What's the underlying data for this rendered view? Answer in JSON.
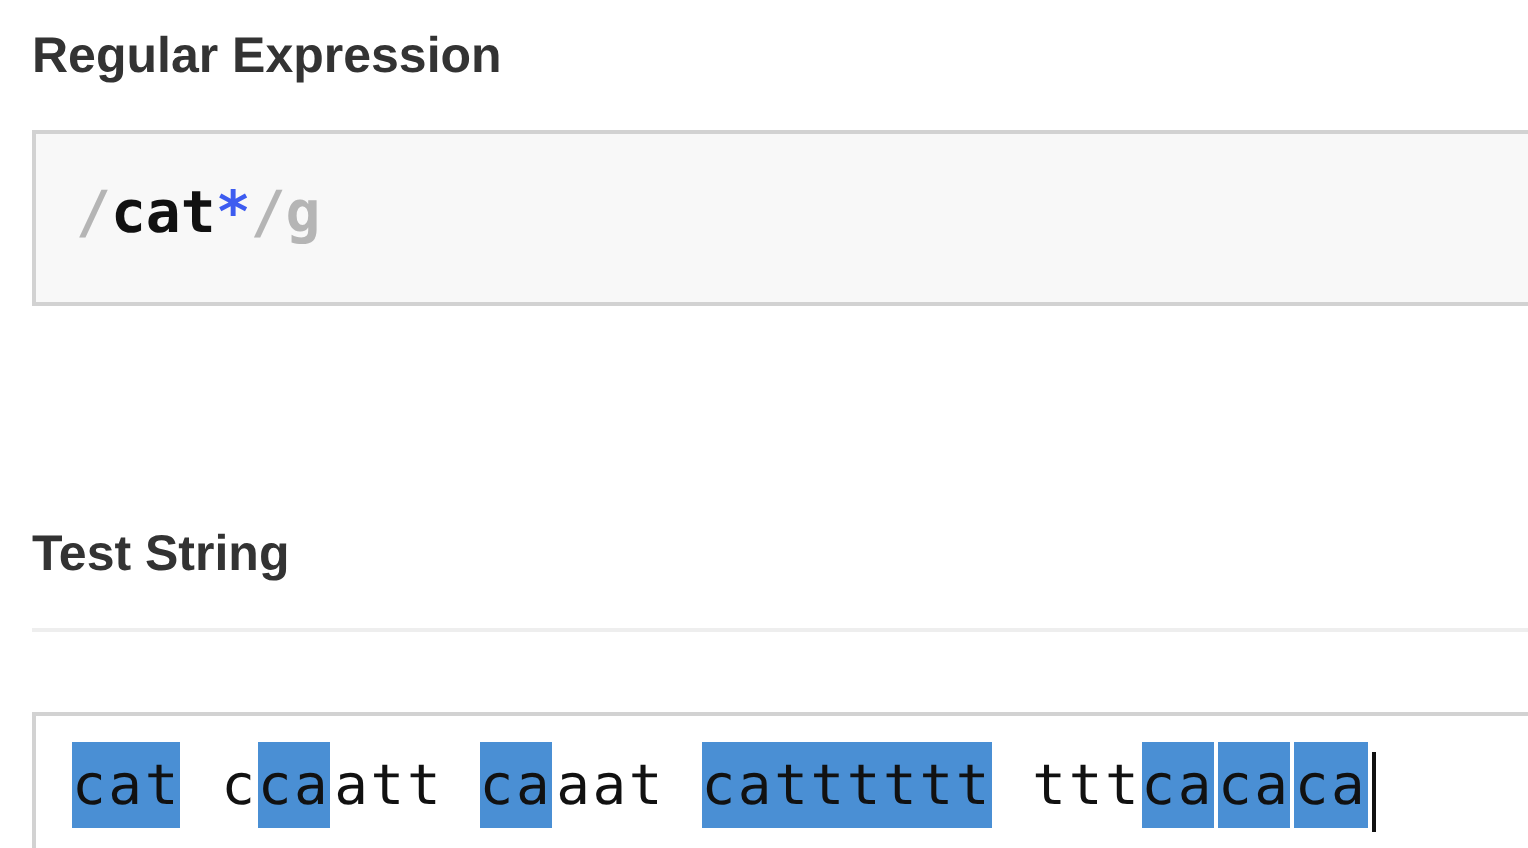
{
  "regex_section": {
    "heading": "Regular Expression",
    "tokens": [
      {
        "kind": "delimiter",
        "text": "/"
      },
      {
        "kind": "literal",
        "text": "cat"
      },
      {
        "kind": "quantifier",
        "text": "*"
      },
      {
        "kind": "delimiter",
        "text": "/"
      },
      {
        "kind": "flags",
        "text": "g"
      }
    ]
  },
  "test_section": {
    "heading": "Test String",
    "segments": [
      {
        "text": "cat",
        "matched": true
      },
      {
        "text": " c",
        "matched": false
      },
      {
        "text": "ca",
        "matched": true
      },
      {
        "text": "att ",
        "matched": false
      },
      {
        "text": "ca",
        "matched": true
      },
      {
        "text": "aat ",
        "matched": false
      },
      {
        "text": "catttttt",
        "matched": true
      },
      {
        "text": " ttt",
        "matched": false
      },
      {
        "text": "ca",
        "matched": true
      },
      {
        "text": "ca",
        "matched": true
      },
      {
        "text": "ca",
        "matched": true
      }
    ]
  }
}
